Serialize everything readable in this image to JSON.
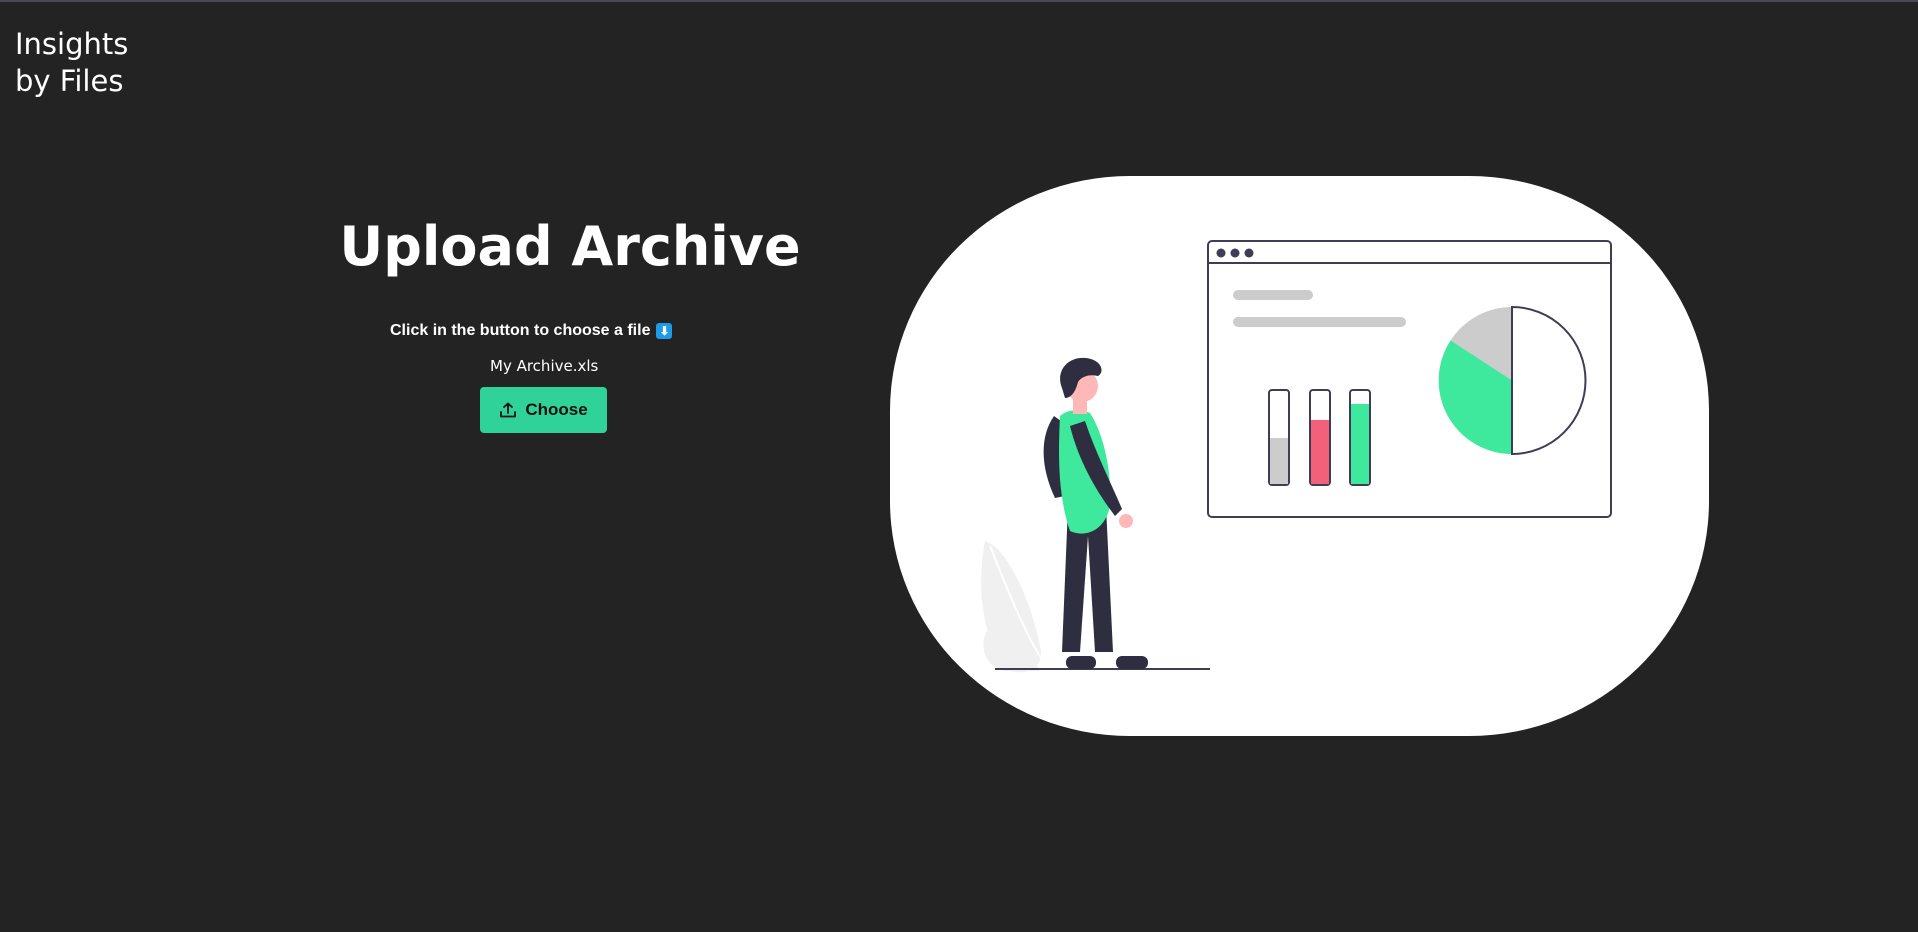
{
  "brand": {
    "line1": "Insights",
    "line2": "by Files"
  },
  "upload": {
    "title": "Upload Archive",
    "instruction": "Click in the button to choose a file",
    "instruction_icon": "down-arrow-icon",
    "file_name": "My Archive.xls",
    "button_label": "Choose",
    "button_icon": "upload-icon"
  },
  "colors": {
    "background": "#232323",
    "accent": "#2fd399",
    "illustration_green": "#3ee89d",
    "illustration_red": "#f2607a",
    "illustration_gray": "#cccccc",
    "illustration_dark": "#2f2e41"
  }
}
